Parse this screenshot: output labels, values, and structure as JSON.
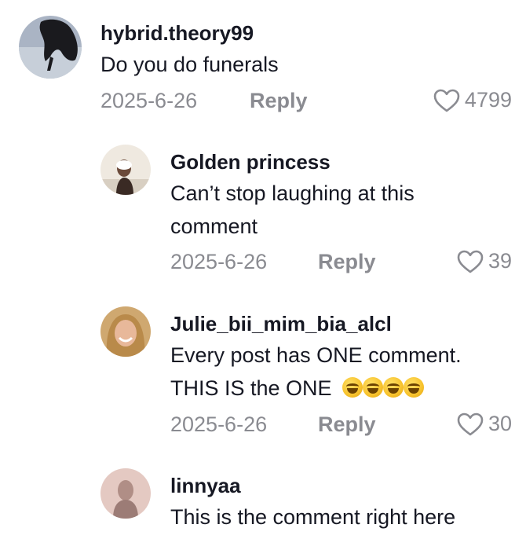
{
  "comments": [
    {
      "username": "hybrid.theory99",
      "text": "Do you do funerals",
      "date": "2025-6-26",
      "reply_label": "Reply",
      "likes": "4799"
    },
    {
      "username": "Golden princess",
      "text_line1": "Can’t stop laughing at this",
      "text_line2": "comment",
      "date": "2025-6-26",
      "reply_label": "Reply",
      "likes": "39"
    },
    {
      "username": "Julie_bii_mim_bia_alcl",
      "text_line1": "Every post has ONE comment.",
      "text_line2": "THIS IS the ONE",
      "emoji": "face-with-tears-of-joy x4",
      "date": "2025-6-26",
      "reply_label": "Reply",
      "likes": "30"
    },
    {
      "username": "linnyaa",
      "text": "This is the comment right here"
    }
  ],
  "colors": {
    "text": "#161823",
    "muted": "#8a8b91",
    "background": "#ffffff"
  },
  "icons": {
    "like": "heart-outline-icon",
    "emoji": "tears-of-joy-emoji-icon"
  }
}
